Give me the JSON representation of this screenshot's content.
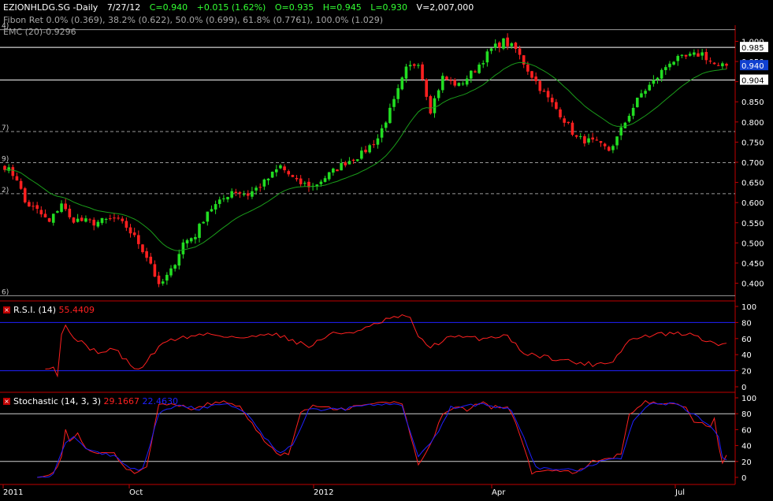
{
  "header": {
    "symbol": "EZIONHLDG.SG -Daily",
    "date": "7/27/12",
    "close": "C=0.940",
    "change": "+0.015 (1.62%)",
    "open": "O=0.935",
    "high": "H=0.945",
    "low": "L=0.930",
    "volume": "V=2,007,000",
    "fib_text": "Fibon Ret 0.0% (0.369), 38.2% (0.622), 50.0% (0.699), 61.8% (0.7761), 100.0% (1.029)",
    "ema_text": "EMC (20)-0.9296"
  },
  "rsi_header": {
    "name": "R.S.I. (14)",
    "value": "55.4409"
  },
  "stoch_header": {
    "name": "Stochastic (14, 3, 3)",
    "k": "29.1667",
    "d": "22.4630"
  },
  "colors": {
    "up": "#22dd22",
    "down": "#ff2020",
    "ema": "#1a9c1a",
    "rsi": "#ff2020",
    "stoch_k": "#ff2020",
    "stoch_d": "#2020ff",
    "fib": "#9a9a9a",
    "axis": "#c00000",
    "price_tag_bg": "#1040d0",
    "header_up": "#33ff33"
  },
  "chart_data": [
    {
      "type": "candlestick",
      "title": "EZIONHLDG.SG -Daily",
      "ylim": [
        0.36,
        1.04
      ],
      "y_ticks": [
        1.0,
        0.95,
        0.9,
        0.85,
        0.8,
        0.75,
        0.7,
        0.65,
        0.6,
        0.55,
        0.5,
        0.45,
        0.4
      ],
      "y_tick_labels": [
        "1.000",
        "0.950",
        "0.900",
        "0.850",
        "0.800",
        "0.750",
        "0.700",
        "0.650",
        "0.600",
        "0.550",
        "0.500",
        "0.450",
        "0.400"
      ],
      "x_labels": [
        "2011",
        "Oct",
        "2012",
        "Apr",
        "Jul"
      ],
      "fib_levels": [
        0.369,
        0.622,
        0.699,
        0.7761,
        1.029
      ],
      "fib_side_labels": [
        "6)",
        "2)",
        "9)",
        "7)",
        "4)"
      ],
      "price_tags": [
        {
          "label": "0.985",
          "value": 0.985,
          "style": "white"
        },
        {
          "label": "0.940",
          "value": 0.94,
          "style": "blue"
        },
        {
          "label": "0.904",
          "value": 0.904,
          "style": "white"
        }
      ],
      "anchors": [
        [
          0,
          0.69
        ],
        [
          3,
          0.66
        ],
        [
          5,
          0.6
        ],
        [
          8,
          0.58
        ],
        [
          11,
          0.55
        ],
        [
          14,
          0.6
        ],
        [
          16,
          0.56
        ],
        [
          22,
          0.55
        ],
        [
          27,
          0.56
        ],
        [
          30,
          0.54
        ],
        [
          33,
          0.5
        ],
        [
          36,
          0.45
        ],
        [
          38,
          0.39
        ],
        [
          41,
          0.43
        ],
        [
          44,
          0.5
        ],
        [
          47,
          0.52
        ],
        [
          50,
          0.58
        ],
        [
          53,
          0.6
        ],
        [
          56,
          0.63
        ],
        [
          60,
          0.62
        ],
        [
          64,
          0.65
        ],
        [
          68,
          0.69
        ],
        [
          72,
          0.65
        ],
        [
          76,
          0.64
        ],
        [
          80,
          0.67
        ],
        [
          84,
          0.7
        ],
        [
          88,
          0.72
        ],
        [
          92,
          0.76
        ],
        [
          96,
          0.85
        ],
        [
          99,
          0.93
        ],
        [
          102,
          0.95
        ],
        [
          105,
          0.83
        ],
        [
          108,
          0.91
        ],
        [
          112,
          0.89
        ],
        [
          116,
          0.93
        ],
        [
          120,
          0.98
        ],
        [
          123,
          1.0
        ],
        [
          126,
          0.98
        ],
        [
          129,
          0.93
        ],
        [
          133,
          0.87
        ],
        [
          137,
          0.82
        ],
        [
          141,
          0.76
        ],
        [
          145,
          0.75
        ],
        [
          149,
          0.73
        ],
        [
          151,
          0.76
        ],
        [
          154,
          0.82
        ],
        [
          157,
          0.87
        ],
        [
          160,
          0.9
        ],
        [
          164,
          0.95
        ],
        [
          168,
          0.96
        ],
        [
          172,
          0.97
        ],
        [
          174,
          0.95
        ],
        [
          176,
          0.935
        ],
        [
          178,
          0.94
        ]
      ]
    },
    {
      "type": "line",
      "title": "R.S.I. (14)",
      "ylim": [
        0,
        100
      ],
      "y_ticks": [
        0,
        20,
        40,
        60,
        80,
        100
      ],
      "levels": [
        20,
        80
      ],
      "anchors": [
        [
          10,
          25
        ],
        [
          12,
          25
        ],
        [
          13,
          15
        ],
        [
          14,
          65
        ],
        [
          15,
          75
        ],
        [
          16,
          68
        ],
        [
          20,
          50
        ],
        [
          24,
          42
        ],
        [
          27,
          48
        ],
        [
          30,
          32
        ],
        [
          33,
          20
        ],
        [
          36,
          38
        ],
        [
          40,
          58
        ],
        [
          50,
          66
        ],
        [
          60,
          60
        ],
        [
          65,
          68
        ],
        [
          70,
          60
        ],
        [
          75,
          50
        ],
        [
          80,
          65
        ],
        [
          88,
          70
        ],
        [
          95,
          85
        ],
        [
          100,
          88
        ],
        [
          102,
          60
        ],
        [
          105,
          50
        ],
        [
          110,
          62
        ],
        [
          118,
          60
        ],
        [
          124,
          65
        ],
        [
          127,
          45
        ],
        [
          130,
          40
        ],
        [
          136,
          35
        ],
        [
          141,
          30
        ],
        [
          145,
          28
        ],
        [
          150,
          32
        ],
        [
          154,
          58
        ],
        [
          160,
          65
        ],
        [
          168,
          66
        ],
        [
          172,
          60
        ],
        [
          175,
          52
        ],
        [
          178,
          55
        ]
      ]
    },
    {
      "type": "line",
      "title": "Stochastic (14, 3, 3)",
      "ylim": [
        0,
        100
      ],
      "y_ticks": [
        0,
        20,
        40,
        60,
        80,
        100
      ],
      "levels": [
        20,
        80
      ],
      "series": [
        {
          "name": "29.1667",
          "color": "#ff2020",
          "anchors": [
            [
              8,
              0
            ],
            [
              12,
              5
            ],
            [
              14,
              25
            ],
            [
              15,
              60
            ],
            [
              16,
              45
            ],
            [
              18,
              55
            ],
            [
              20,
              35
            ],
            [
              23,
              30
            ],
            [
              27,
              30
            ],
            [
              30,
              10
            ],
            [
              32,
              5
            ],
            [
              35,
              15
            ],
            [
              38,
              90
            ],
            [
              42,
              92
            ],
            [
              47,
              85
            ],
            [
              50,
              92
            ],
            [
              54,
              95
            ],
            [
              58,
              90
            ],
            [
              62,
              60
            ],
            [
              65,
              40
            ],
            [
              68,
              28
            ],
            [
              70,
              30
            ],
            [
              73,
              80
            ],
            [
              76,
              90
            ],
            [
              82,
              85
            ],
            [
              88,
              90
            ],
            [
              94,
              95
            ],
            [
              98,
              92
            ],
            [
              102,
              15
            ],
            [
              105,
              40
            ],
            [
              108,
              80
            ],
            [
              111,
              90
            ],
            [
              114,
              85
            ],
            [
              118,
              95
            ],
            [
              120,
              88
            ],
            [
              124,
              90
            ],
            [
              126,
              70
            ],
            [
              128,
              40
            ],
            [
              130,
              5
            ],
            [
              136,
              10
            ],
            [
              141,
              5
            ],
            [
              145,
              20
            ],
            [
              150,
              25
            ],
            [
              152,
              30
            ],
            [
              154,
              80
            ],
            [
              158,
              95
            ],
            [
              164,
              92
            ],
            [
              168,
              90
            ],
            [
              170,
              70
            ],
            [
              174,
              65
            ],
            [
              175,
              75
            ],
            [
              176,
              40
            ],
            [
              177,
              18
            ],
            [
              178,
              29
            ]
          ]
        },
        {
          "name": "22.4630",
          "color": "#2020ff",
          "anchors": [
            [
              8,
              0
            ],
            [
              12,
              3
            ],
            [
              15,
              45
            ],
            [
              17,
              52
            ],
            [
              20,
              38
            ],
            [
              24,
              30
            ],
            [
              28,
              25
            ],
            [
              31,
              10
            ],
            [
              34,
              10
            ],
            [
              38,
              80
            ],
            [
              43,
              90
            ],
            [
              48,
              86
            ],
            [
              55,
              93
            ],
            [
              60,
              80
            ],
            [
              64,
              50
            ],
            [
              68,
              30
            ],
            [
              71,
              40
            ],
            [
              75,
              85
            ],
            [
              84,
              86
            ],
            [
              92,
              92
            ],
            [
              98,
              90
            ],
            [
              102,
              25
            ],
            [
              106,
              50
            ],
            [
              110,
              88
            ],
            [
              118,
              92
            ],
            [
              125,
              85
            ],
            [
              128,
              50
            ],
            [
              131,
              12
            ],
            [
              137,
              10
            ],
            [
              142,
              8
            ],
            [
              147,
              20
            ],
            [
              152,
              25
            ],
            [
              155,
              70
            ],
            [
              159,
              92
            ],
            [
              166,
              92
            ],
            [
              170,
              78
            ],
            [
              174,
              65
            ],
            [
              176,
              50
            ],
            [
              177,
              25
            ],
            [
              178,
              22
            ]
          ]
        }
      ]
    }
  ]
}
